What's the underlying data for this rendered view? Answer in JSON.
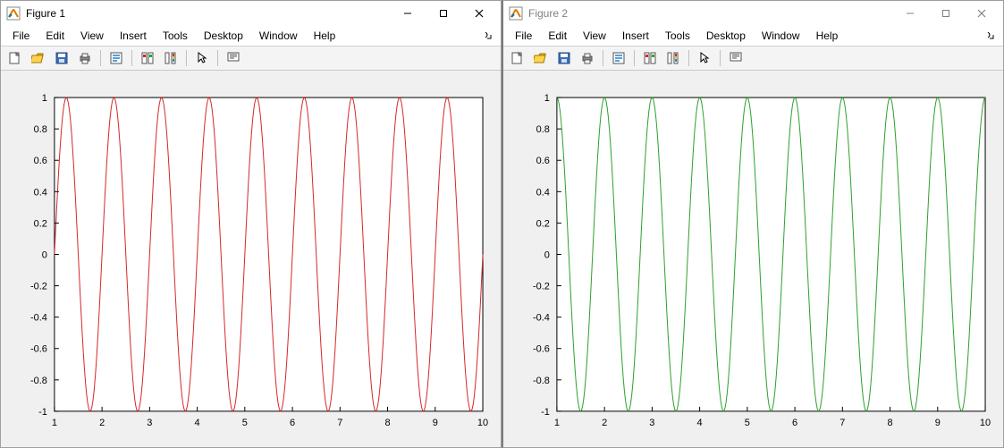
{
  "menus": [
    "File",
    "Edit",
    "View",
    "Insert",
    "Tools",
    "Desktop",
    "Window",
    "Help"
  ],
  "toolbar_icons": [
    "new-figure-icon",
    "open-icon",
    "save-icon",
    "print-icon",
    "sep",
    "print-preview-icon",
    "sep",
    "link-axes-icon",
    "insert-colorbar-icon",
    "sep",
    "pointer-icon",
    "sep",
    "data-tips-icon"
  ],
  "figures": [
    {
      "title": "Figure 1",
      "active": true,
      "chart_ref": 0
    },
    {
      "title": "Figure 2",
      "active": false,
      "chart_ref": 1
    }
  ],
  "chart_data": [
    {
      "type": "line",
      "color": "#d62728",
      "function": "sin(2*pi*x)",
      "x_range": [
        1,
        10
      ],
      "y_range": [
        -1,
        1
      ],
      "x_ticks": [
        1,
        2,
        3,
        4,
        5,
        6,
        7,
        8,
        9,
        10
      ],
      "y_ticks": [
        -1,
        -0.8,
        -0.6,
        -0.4,
        -0.2,
        0,
        0.2,
        0.4,
        0.6,
        0.8,
        1
      ],
      "samples": 400
    },
    {
      "type": "line",
      "color": "#2ca02c",
      "function": "cos(2*pi*x)",
      "x_range": [
        1,
        10
      ],
      "y_range": [
        -1,
        1
      ],
      "x_ticks": [
        1,
        2,
        3,
        4,
        5,
        6,
        7,
        8,
        9,
        10
      ],
      "y_ticks": [
        -1,
        -0.8,
        -0.6,
        -0.4,
        -0.2,
        0,
        0.2,
        0.4,
        0.6,
        0.8,
        1
      ],
      "samples": 400
    }
  ]
}
